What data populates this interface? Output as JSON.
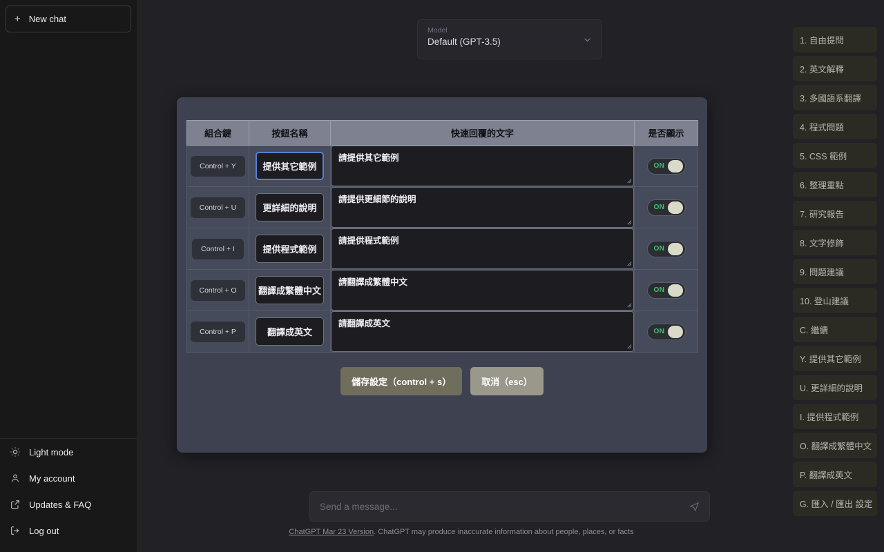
{
  "sidebar": {
    "new_chat": {
      "label": "New chat",
      "icon": "plus-icon"
    },
    "bottom_items": [
      {
        "label": "Light mode",
        "icon": "sun-icon"
      },
      {
        "label": "My account",
        "icon": "user-icon"
      },
      {
        "label": "Updates & FAQ",
        "icon": "external-link-icon"
      },
      {
        "label": "Log out",
        "icon": "logout-icon"
      }
    ]
  },
  "model_selector": {
    "label": "Model",
    "value": "Default (GPT-3.5)",
    "icon": "chevron-down-icon"
  },
  "modal": {
    "columns": [
      "組合鍵",
      "按鈕名稱",
      "快速回覆的文字",
      "是否顯示"
    ],
    "rows": [
      {
        "key": "Control + Y",
        "name": "提供其它範例",
        "reply": "請提供其它範例",
        "toggle": "ON",
        "focused": true
      },
      {
        "key": "Control + U",
        "name": "更詳細的說明",
        "reply": "請提供更細節的說明",
        "toggle": "ON",
        "focused": false
      },
      {
        "key": "Control + I",
        "name": "提供程式範例",
        "reply": "請提供程式範例",
        "toggle": "ON",
        "focused": false
      },
      {
        "key": "Control + O",
        "name": "翻譯成繁體中文",
        "reply": "請翻譯成繁體中文",
        "toggle": "ON",
        "focused": false
      },
      {
        "key": "Control + P",
        "name": "翻譯成英文",
        "reply": "請翻譯成英文",
        "toggle": "ON",
        "focused": false
      }
    ],
    "save_label": "儲存設定（control + s）",
    "cancel_label": "取消（esc）"
  },
  "composer": {
    "placeholder": "Send a message...",
    "send_icon": "send-icon"
  },
  "footer": {
    "link_text": "ChatGPT Mar 23 Version",
    "rest_text": ". ChatGPT may produce inaccurate information about people, places, or facts"
  },
  "right_panel": {
    "items": [
      "1. 自由提問",
      "2. 英文解釋",
      "3. 多國語系翻譯",
      "4. 程式問題",
      "5. CSS 範例",
      "6. 整理重點",
      "7. 研究報告",
      "8. 文字修飾",
      "9. 問題建議",
      "10. 登山建議",
      "C. 繼續",
      "Y. 提供其它範例",
      "U. 更詳細的說明",
      "I. 提供程式範例",
      "O. 翻譯成繁體中文",
      "P. 翻譯成英文",
      "G. 匯入 / 匯出 設定"
    ]
  },
  "colors": {
    "app_background": "#212126",
    "sidebar_background": "#181818",
    "modal_background": "#3e4250",
    "table_header": "#7d8190",
    "toggle_on_text": "#3ec46d",
    "focus_ring": "#5b7fd4",
    "save_button": "#6f6d5c",
    "cancel_button": "#9a978b"
  }
}
